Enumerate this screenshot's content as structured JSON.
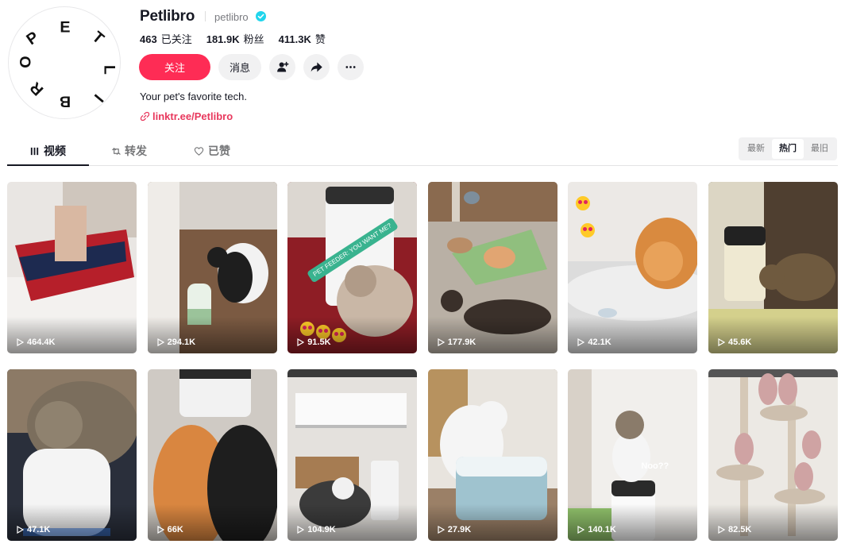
{
  "profile": {
    "username": "Petlibro",
    "nickname": "petlibro",
    "avatar_letters": [
      "P",
      "E",
      "T",
      "L",
      "I",
      "B",
      "R",
      "O"
    ],
    "following_count": "463",
    "following_label": "已关注",
    "followers_count": "181.9K",
    "followers_label": "粉丝",
    "likes_count": "411.3K",
    "likes_label": "赞",
    "bio": "Your pet's favorite tech.",
    "link": "linktr.ee/Petlibro"
  },
  "actions": {
    "follow_label": "关注",
    "message_label": "消息"
  },
  "tabs": [
    {
      "label": "视频",
      "icon": "grid-icon"
    },
    {
      "label": "转发",
      "icon": "repost-icon"
    },
    {
      "label": "已赞",
      "icon": "heart-icon"
    }
  ],
  "sort": [
    "最新",
    "热门",
    "最旧"
  ],
  "videos": [
    {
      "views": "464.4K"
    },
    {
      "views": "294.1K"
    },
    {
      "views": "91.5K",
      "sticker": "PET FEEDER: YOU WANT ME?"
    },
    {
      "views": "177.9K"
    },
    {
      "views": "42.1K"
    },
    {
      "views": "45.6K"
    },
    {
      "views": "47.1K"
    },
    {
      "views": "66K"
    },
    {
      "views": "104.9K"
    },
    {
      "views": "27.9K"
    },
    {
      "views": "140.1K",
      "caption": "Noo??"
    },
    {
      "views": "82.5K"
    }
  ]
}
